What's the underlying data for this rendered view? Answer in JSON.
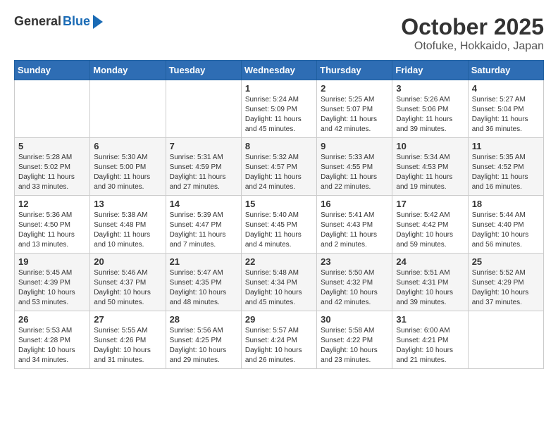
{
  "header": {
    "logo_general": "General",
    "logo_blue": "Blue",
    "month_title": "October 2025",
    "location": "Otofuke, Hokkaido, Japan"
  },
  "weekdays": [
    "Sunday",
    "Monday",
    "Tuesday",
    "Wednesday",
    "Thursday",
    "Friday",
    "Saturday"
  ],
  "weeks": [
    [
      {
        "day": "",
        "info": ""
      },
      {
        "day": "",
        "info": ""
      },
      {
        "day": "",
        "info": ""
      },
      {
        "day": "1",
        "info": "Sunrise: 5:24 AM\nSunset: 5:09 PM\nDaylight: 11 hours\nand 45 minutes."
      },
      {
        "day": "2",
        "info": "Sunrise: 5:25 AM\nSunset: 5:07 PM\nDaylight: 11 hours\nand 42 minutes."
      },
      {
        "day": "3",
        "info": "Sunrise: 5:26 AM\nSunset: 5:06 PM\nDaylight: 11 hours\nand 39 minutes."
      },
      {
        "day": "4",
        "info": "Sunrise: 5:27 AM\nSunset: 5:04 PM\nDaylight: 11 hours\nand 36 minutes."
      }
    ],
    [
      {
        "day": "5",
        "info": "Sunrise: 5:28 AM\nSunset: 5:02 PM\nDaylight: 11 hours\nand 33 minutes."
      },
      {
        "day": "6",
        "info": "Sunrise: 5:30 AM\nSunset: 5:00 PM\nDaylight: 11 hours\nand 30 minutes."
      },
      {
        "day": "7",
        "info": "Sunrise: 5:31 AM\nSunset: 4:59 PM\nDaylight: 11 hours\nand 27 minutes."
      },
      {
        "day": "8",
        "info": "Sunrise: 5:32 AM\nSunset: 4:57 PM\nDaylight: 11 hours\nand 24 minutes."
      },
      {
        "day": "9",
        "info": "Sunrise: 5:33 AM\nSunset: 4:55 PM\nDaylight: 11 hours\nand 22 minutes."
      },
      {
        "day": "10",
        "info": "Sunrise: 5:34 AM\nSunset: 4:53 PM\nDaylight: 11 hours\nand 19 minutes."
      },
      {
        "day": "11",
        "info": "Sunrise: 5:35 AM\nSunset: 4:52 PM\nDaylight: 11 hours\nand 16 minutes."
      }
    ],
    [
      {
        "day": "12",
        "info": "Sunrise: 5:36 AM\nSunset: 4:50 PM\nDaylight: 11 hours\nand 13 minutes."
      },
      {
        "day": "13",
        "info": "Sunrise: 5:38 AM\nSunset: 4:48 PM\nDaylight: 11 hours\nand 10 minutes."
      },
      {
        "day": "14",
        "info": "Sunrise: 5:39 AM\nSunset: 4:47 PM\nDaylight: 11 hours\nand 7 minutes."
      },
      {
        "day": "15",
        "info": "Sunrise: 5:40 AM\nSunset: 4:45 PM\nDaylight: 11 hours\nand 4 minutes."
      },
      {
        "day": "16",
        "info": "Sunrise: 5:41 AM\nSunset: 4:43 PM\nDaylight: 11 hours\nand 2 minutes."
      },
      {
        "day": "17",
        "info": "Sunrise: 5:42 AM\nSunset: 4:42 PM\nDaylight: 10 hours\nand 59 minutes."
      },
      {
        "day": "18",
        "info": "Sunrise: 5:44 AM\nSunset: 4:40 PM\nDaylight: 10 hours\nand 56 minutes."
      }
    ],
    [
      {
        "day": "19",
        "info": "Sunrise: 5:45 AM\nSunset: 4:39 PM\nDaylight: 10 hours\nand 53 minutes."
      },
      {
        "day": "20",
        "info": "Sunrise: 5:46 AM\nSunset: 4:37 PM\nDaylight: 10 hours\nand 50 minutes."
      },
      {
        "day": "21",
        "info": "Sunrise: 5:47 AM\nSunset: 4:35 PM\nDaylight: 10 hours\nand 48 minutes."
      },
      {
        "day": "22",
        "info": "Sunrise: 5:48 AM\nSunset: 4:34 PM\nDaylight: 10 hours\nand 45 minutes."
      },
      {
        "day": "23",
        "info": "Sunrise: 5:50 AM\nSunset: 4:32 PM\nDaylight: 10 hours\nand 42 minutes."
      },
      {
        "day": "24",
        "info": "Sunrise: 5:51 AM\nSunset: 4:31 PM\nDaylight: 10 hours\nand 39 minutes."
      },
      {
        "day": "25",
        "info": "Sunrise: 5:52 AM\nSunset: 4:29 PM\nDaylight: 10 hours\nand 37 minutes."
      }
    ],
    [
      {
        "day": "26",
        "info": "Sunrise: 5:53 AM\nSunset: 4:28 PM\nDaylight: 10 hours\nand 34 minutes."
      },
      {
        "day": "27",
        "info": "Sunrise: 5:55 AM\nSunset: 4:26 PM\nDaylight: 10 hours\nand 31 minutes."
      },
      {
        "day": "28",
        "info": "Sunrise: 5:56 AM\nSunset: 4:25 PM\nDaylight: 10 hours\nand 29 minutes."
      },
      {
        "day": "29",
        "info": "Sunrise: 5:57 AM\nSunset: 4:24 PM\nDaylight: 10 hours\nand 26 minutes."
      },
      {
        "day": "30",
        "info": "Sunrise: 5:58 AM\nSunset: 4:22 PM\nDaylight: 10 hours\nand 23 minutes."
      },
      {
        "day": "31",
        "info": "Sunrise: 6:00 AM\nSunset: 4:21 PM\nDaylight: 10 hours\nand 21 minutes."
      },
      {
        "day": "",
        "info": ""
      }
    ]
  ]
}
